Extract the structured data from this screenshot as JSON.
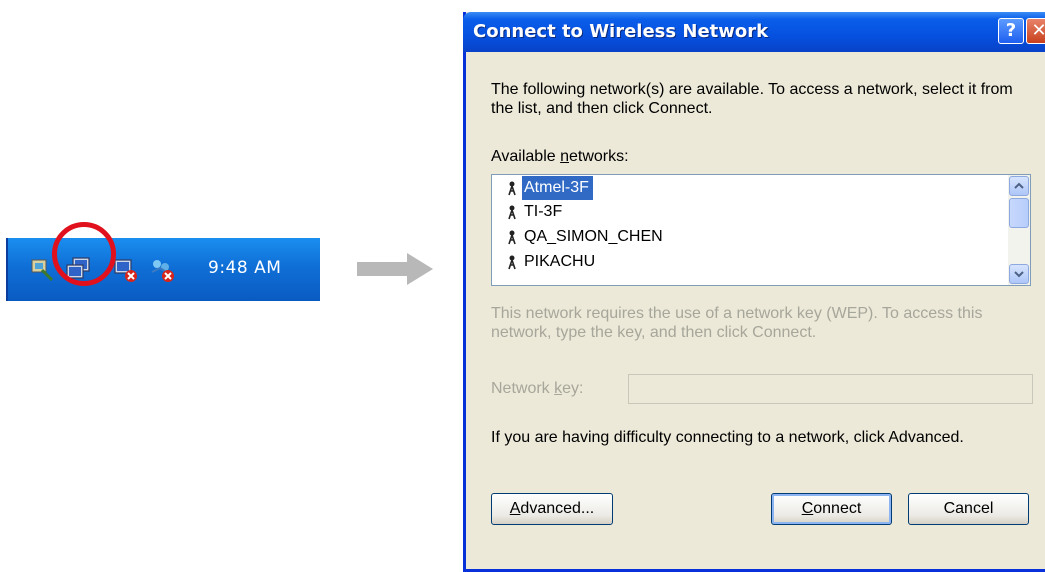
{
  "tray": {
    "clock": "9:48 AM",
    "icons": [
      "network-tray-icon",
      "wireless-network-icon",
      "disconnected-network-icon",
      "network-error-icon"
    ]
  },
  "dialog": {
    "title": "Connect to Wireless Network",
    "intro": "The following network(s) are available. To access a network, select it from the list, and then click Connect.",
    "available_label_pre": "Available ",
    "available_label_ul": "n",
    "available_label_post": "etworks:",
    "networks": [
      {
        "name": "Atmel-3F",
        "selected": true
      },
      {
        "name": "TI-3F",
        "selected": false
      },
      {
        "name": "QA_SIMON_CHEN",
        "selected": false
      },
      {
        "name": "PIKACHU",
        "selected": false
      }
    ],
    "wep_note": "This network requires the use of a network key (WEP). To access this network, type the key, and then click Connect.",
    "key_label_pre": "Network ",
    "key_label_ul": "k",
    "key_label_post": "ey:",
    "key_value": "",
    "advanced_note": "If you are having difficulty connecting to a network, click Advanced.",
    "buttons": {
      "advanced_ul": "A",
      "advanced_rest": "dvanced...",
      "connect_ul": "C",
      "connect_rest": "onnect",
      "cancel": "Cancel"
    }
  },
  "colors": {
    "titlebar": "#0650e0",
    "dialog_bg": "#ece9d8",
    "selection": "#316ac5",
    "highlight_circle": "#e0101d",
    "taskbar": "#0f6fd6"
  }
}
